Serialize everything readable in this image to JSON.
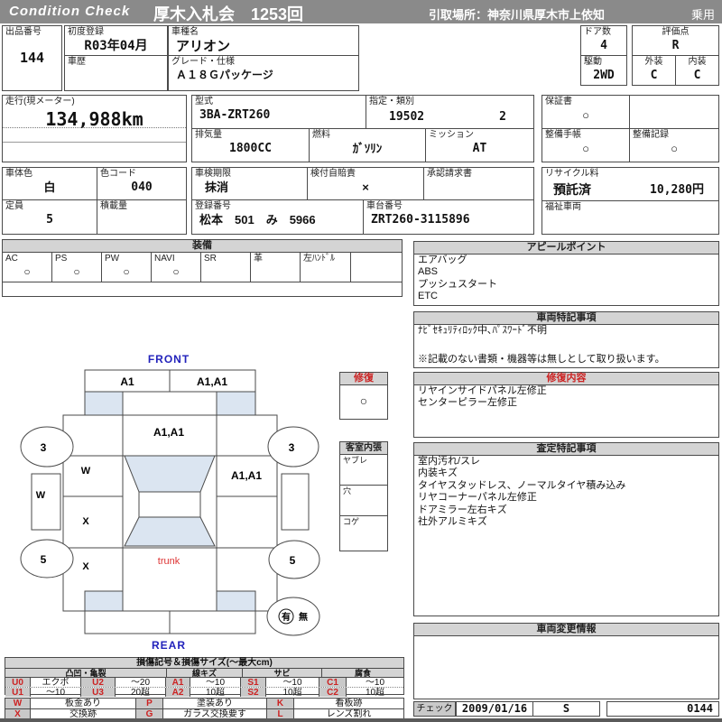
{
  "colors": {
    "header_bg": "#8a8a8a",
    "titlebar_bg": "#d4d4d4",
    "accent_red": "#cc2222",
    "label_blue": "#2222bb",
    "glass_blue": "#dbe5f1"
  },
  "header": {
    "brand": "Condition  Check",
    "auction": "厚木入札会　1253回",
    "pickup": "引取場所：神奈川県厚木市上依知",
    "category": "乗用"
  },
  "vehicle": {
    "lot_label": "出品番号",
    "lot": "144",
    "first_reg_label": "初度登録",
    "first_reg": "R03年04月",
    "history_label": "車歴",
    "history": "",
    "model_label": "車種名",
    "model": "アリオン",
    "grade_label": "グレード・仕様",
    "grade": "Ａ１８Ｇパッケージ",
    "doors_label": "ドア数",
    "doors": "4",
    "drive_label": "駆動",
    "drive": "2WD",
    "score_label": "評価点",
    "score": "R",
    "exterior_label": "外装",
    "exterior": "C",
    "interior_label": "内装",
    "interior": "C",
    "odo_label": "走行(現メーター)",
    "odo": "134,988km",
    "model_code_label": "型式",
    "model_code": "3BA-ZRT260",
    "class_label": "指定・類別",
    "class_no": "19502",
    "class_no2": "2",
    "displacement_label": "排気量",
    "displacement": "1800CC",
    "fuel_label": "燃料",
    "fuel": "ｶﾞｿﾘﾝ",
    "mission_label": "ミッション",
    "mission": "AT",
    "warranty_label": "保証書",
    "warranty": "○",
    "maintenance_book_label": "整備手帳",
    "maintenance_book": "○",
    "maintenance_record_label": "整備記録",
    "maintenance_record": "○",
    "body_color_label": "車体色",
    "body_color": "白",
    "color_code_label": "色コード",
    "color_code": "040",
    "shaken_label": "車検期限",
    "shaken": "抹消",
    "insurance_label": "検付自賠責",
    "insurance": "×",
    "approval_label": "承認請求書",
    "approval": "",
    "capacity_label": "定員",
    "capacity": "5",
    "load_label": "積載量",
    "load": "",
    "reg_no_label": "登録番号",
    "reg_no": "松本　501　み　5966",
    "chassis_no_label": "車台番号",
    "chassis_no": "ZRT260-3115896",
    "recycle_label": "リサイクル料",
    "recycle_status": "預託済",
    "recycle_fee": "10,280円",
    "welfare_label": "福祉車両",
    "welfare": ""
  },
  "equipment": {
    "title": "装備",
    "items": [
      {
        "label": "AC",
        "value": "○"
      },
      {
        "label": "PS",
        "value": "○"
      },
      {
        "label": "PW",
        "value": "○"
      },
      {
        "label": "NAVI",
        "value": "○"
      },
      {
        "label": "SR",
        "value": ""
      },
      {
        "label": "革",
        "value": ""
      },
      {
        "label": "左ﾊﾝﾄﾞﾙ",
        "value": ""
      },
      {
        "label": "",
        "value": ""
      }
    ]
  },
  "appeal": {
    "title": "アピールポイント",
    "items": [
      "エアバッグ",
      "ABS",
      "プッシュスタート",
      "ETC"
    ]
  },
  "special_notes": {
    "title": "車両特記事項",
    "items": [
      "ﾅﾋﾞｾｷｭﾘﾃｨﾛｯｸ中､ﾊﾟｽﾜｰﾄﾞ不明"
    ],
    "footnote": "※記載のない書類・機器等は無しとして取り扱います。"
  },
  "repair_details": {
    "title": "修復内容",
    "items": [
      "リヤインサイドパネル左修正",
      "センターピラー左修正"
    ]
  },
  "assessment_notes": {
    "title": "査定特記事項",
    "items": [
      "室内汚れ/スレ",
      "内装キズ",
      "タイヤスタッドレス、ノーマルタイヤ積み込み",
      "リヤコーナーパネル左修正",
      "ドアミラー左右キズ",
      "社外アルミキズ"
    ]
  },
  "change_info": {
    "title": "車両変更情報"
  },
  "check": {
    "label": "チェック",
    "date": "2009/01/16",
    "inspector": "S",
    "sheet_no": "0144"
  },
  "diagram": {
    "front_label": "FRONT",
    "rear_label": "REAR",
    "trunk_label": "trunk",
    "repair_flag": {
      "title": "修復",
      "value": "○"
    },
    "cabin_lining": {
      "title": "客室内張",
      "rows": [
        "ヤブレ",
        "穴",
        "コゲ"
      ]
    },
    "marks": {
      "front_bumper_left": "A1",
      "front_bumper_right": "A1,A1",
      "hood": "A1,A1",
      "right_front_door": "A1,A1",
      "left_fender": "W",
      "left_front_panel": "W",
      "left_front_door": "X",
      "left_rear_door": "X",
      "front_wheel_left": "3",
      "front_wheel_right": "3",
      "rear_wheel_left": "5",
      "rear_wheel_right": "5",
      "spare_has": "有",
      "spare_none": "無"
    }
  },
  "legend_damage": {
    "title": "損傷記号＆損傷サイズ(〜最大cm)",
    "groups": [
      "凸凹・亀裂",
      "線キズ",
      "サビ",
      "腐食"
    ],
    "row1": [
      "U0",
      "エクボ",
      "U2",
      "〜20",
      "A1",
      "〜10",
      "S1",
      "〜10",
      "C1",
      "〜10"
    ],
    "row2": [
      "U1",
      "〜10",
      "U3",
      "20超",
      "A2",
      "10超",
      "S2",
      "10超",
      "C2",
      "10超"
    ]
  },
  "legend_codes": {
    "row1": [
      "W",
      "板金あり",
      "P",
      "塗装あり",
      "K",
      "看板跡"
    ],
    "row2": [
      "X",
      "交換跡",
      "G",
      "ガラス交換要す",
      "L",
      "レンズ割れ"
    ]
  }
}
